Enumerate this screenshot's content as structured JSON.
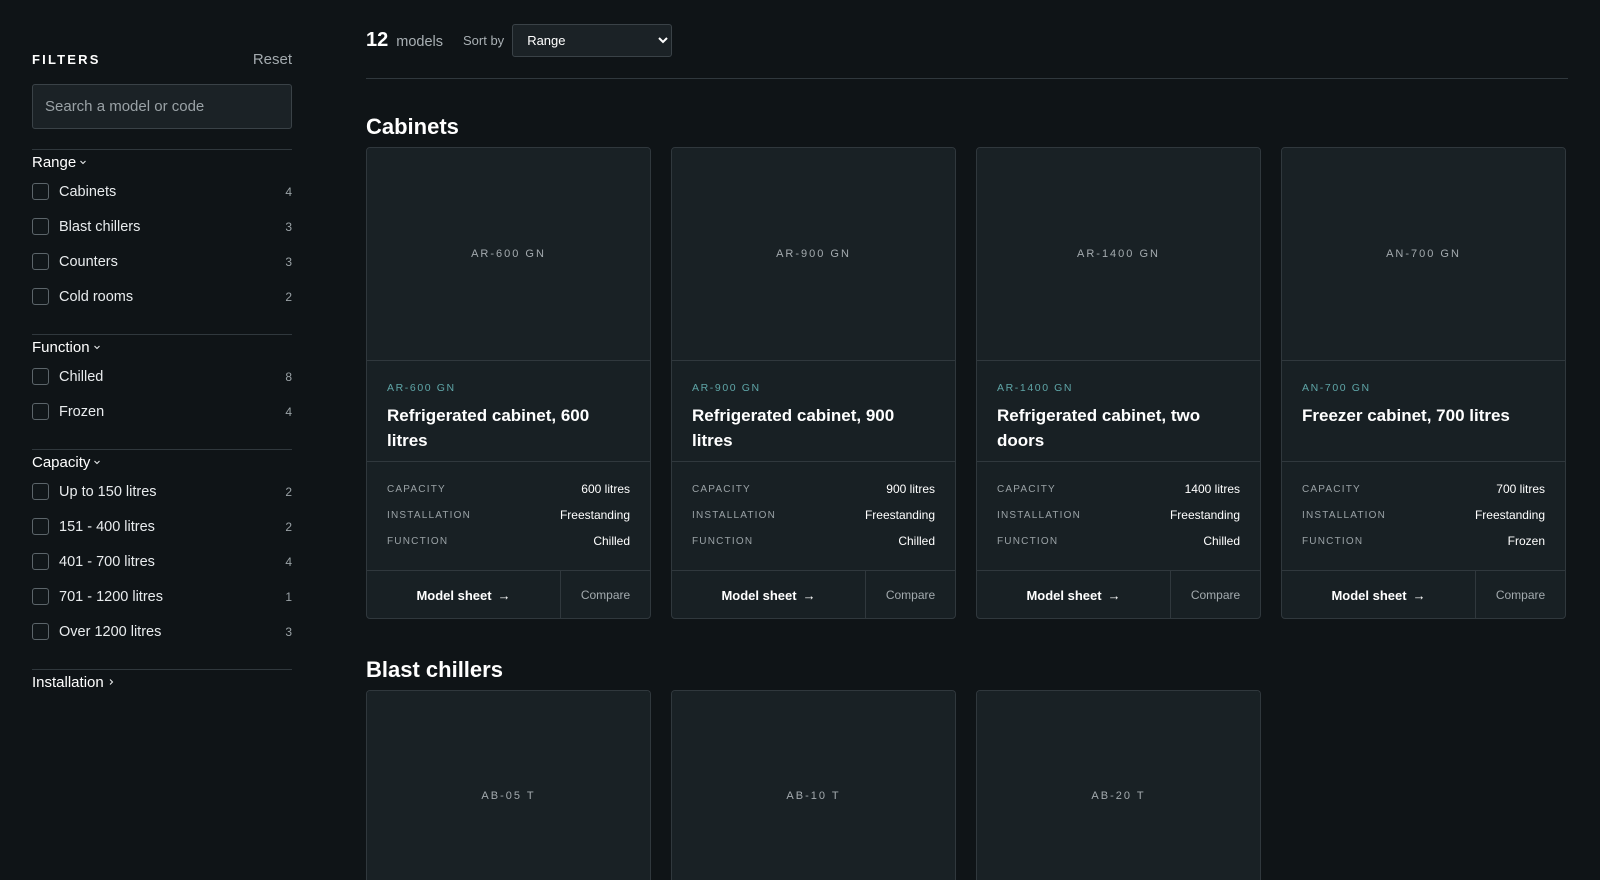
{
  "sidebar": {
    "title": "FILTERS",
    "reset": "Reset",
    "search_placeholder": "Search a model or code",
    "groups": [
      {
        "label": "Range",
        "expanded": true,
        "items": [
          {
            "label": "Cabinets",
            "count": "4"
          },
          {
            "label": "Blast chillers",
            "count": "3"
          },
          {
            "label": "Counters",
            "count": "3"
          },
          {
            "label": "Cold rooms",
            "count": "2"
          }
        ]
      },
      {
        "label": "Function",
        "expanded": true,
        "items": [
          {
            "label": "Chilled",
            "count": "8"
          },
          {
            "label": "Frozen",
            "count": "4"
          }
        ]
      },
      {
        "label": "Capacity",
        "expanded": true,
        "items": [
          {
            "label": "Up to 150 litres",
            "count": "2"
          },
          {
            "label": "151 - 400 litres",
            "count": "2"
          },
          {
            "label": "401 - 700 litres",
            "count": "4"
          },
          {
            "label": "701 - 1200 litres",
            "count": "1"
          },
          {
            "label": "Over 1200 litres",
            "count": "3"
          }
        ]
      },
      {
        "label": "Installation",
        "expanded": false,
        "items": []
      }
    ]
  },
  "toolbar": {
    "count": "12",
    "count_label": "models",
    "sort_label": "Sort by",
    "sort_value": "Range"
  },
  "sections": [
    {
      "title": "Cabinets",
      "cards": [
        {
          "image_label": "AR-600 GN",
          "code": "AR-600 GN",
          "name": "Refrigerated cabinet, 600 litres",
          "specs": [
            {
              "key": "CAPACITY",
              "value": "600 litres"
            },
            {
              "key": "INSTALLATION",
              "value": "Freestanding"
            },
            {
              "key": "FUNCTION",
              "value": "Chilled"
            }
          ],
          "sheet_label": "Model sheet",
          "compare_label": "Compare"
        },
        {
          "image_label": "AR-900 GN",
          "code": "AR-900 GN",
          "name": "Refrigerated cabinet, 900 litres",
          "specs": [
            {
              "key": "CAPACITY",
              "value": "900 litres"
            },
            {
              "key": "INSTALLATION",
              "value": "Freestanding"
            },
            {
              "key": "FUNCTION",
              "value": "Chilled"
            }
          ],
          "sheet_label": "Model sheet",
          "compare_label": "Compare"
        },
        {
          "image_label": "AR-1400 GN",
          "code": "AR-1400 GN",
          "name": "Refrigerated cabinet, two doors",
          "specs": [
            {
              "key": "CAPACITY",
              "value": "1400 litres"
            },
            {
              "key": "INSTALLATION",
              "value": "Freestanding"
            },
            {
              "key": "FUNCTION",
              "value": "Chilled"
            }
          ],
          "sheet_label": "Model sheet",
          "compare_label": "Compare"
        },
        {
          "image_label": "AN-700 GN",
          "code": "AN-700 GN",
          "name": "Freezer cabinet, 700 litres",
          "specs": [
            {
              "key": "CAPACITY",
              "value": "700 litres"
            },
            {
              "key": "INSTALLATION",
              "value": "Freestanding"
            },
            {
              "key": "FUNCTION",
              "value": "Frozen"
            }
          ],
          "sheet_label": "Model sheet",
          "compare_label": "Compare"
        }
      ]
    },
    {
      "title": "Blast chillers",
      "cards": [
        {
          "image_label": "AB-05 T"
        },
        {
          "image_label": "AB-10 T"
        },
        {
          "image_label": "AB-20 T"
        }
      ]
    }
  ],
  "colors": {
    "background": "#0f1417",
    "card": "#182024",
    "border": "#30383d",
    "accent_code": "#5fa6a8"
  },
  "icons": {
    "chevron_down": "chevron-down-icon",
    "chevron_right": "chevron-right-icon",
    "arrow_right": "arrow-right-icon"
  }
}
